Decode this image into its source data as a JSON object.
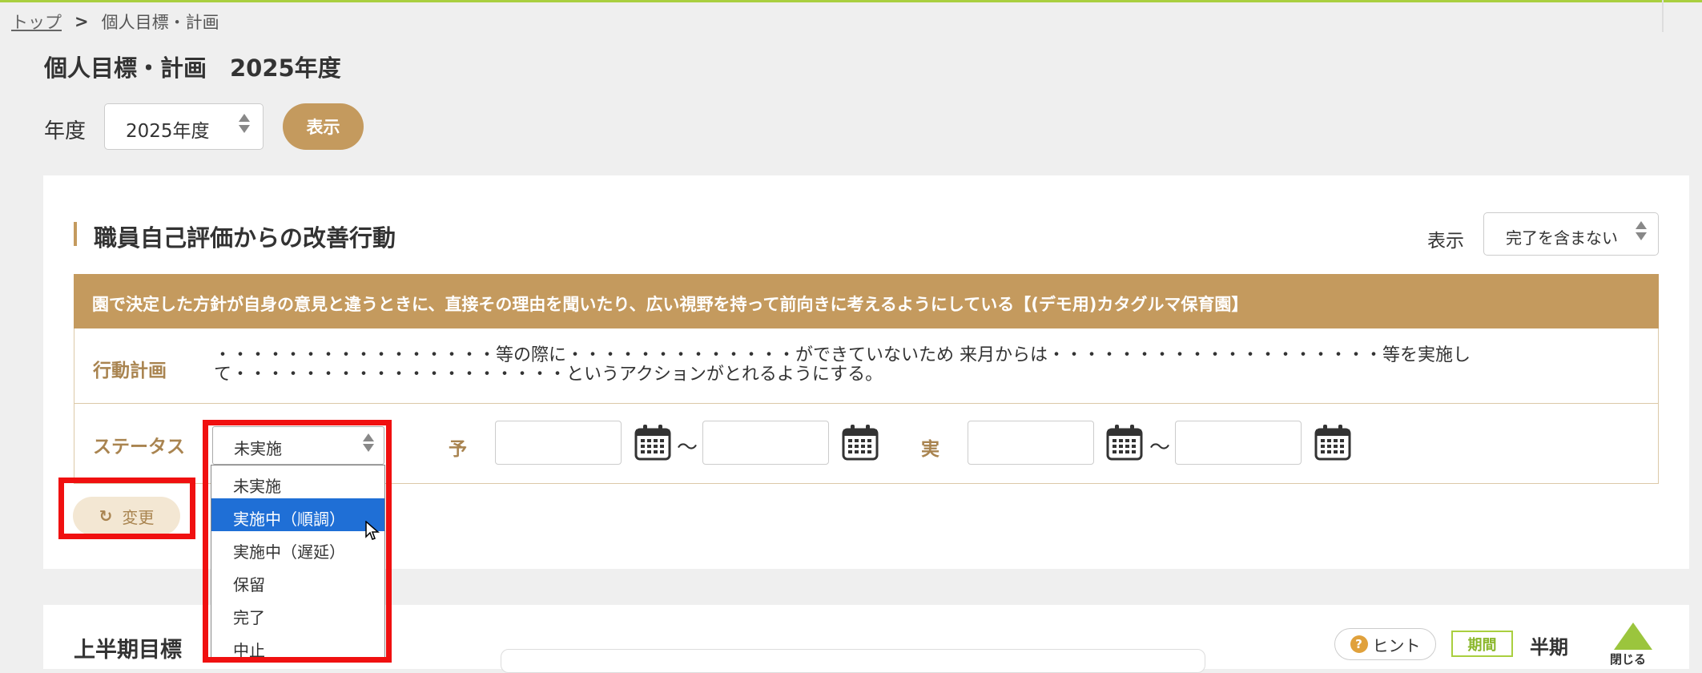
{
  "breadcrumb": {
    "home": "トップ",
    "separator": ">",
    "current": "個人目標・計画"
  },
  "page": {
    "title": "個人目標・計画　2025年度"
  },
  "year_filter": {
    "label": "年度",
    "selected": "2025年度",
    "show_button": "表示"
  },
  "section": {
    "title": "職員自己評価からの改善行動",
    "display_label": "表示",
    "display_selected": "完了を含まない",
    "goal_header": "園で決定した方針が自身の意見と違うときに、直接その理由を聞いたり、広い視野を持って前向きに考えるようにしている【(デモ用)カタグルマ保育園】",
    "plan_label": "行動計画",
    "plan_text": "・・・・・・・・・・・・・・・・等の際に・・・・・・・・・・・・・ができていないため 来月からは・・・・・・・・・・・・・・・・・・・等を実施して・・・・・・・・・・・・・・・・・・・というアクションがとれるようにする。",
    "status_label": "ステータス",
    "status_selected": "未実施",
    "planned_label": "予",
    "actual_label": "実",
    "tilde": "〜",
    "change_button": "変更"
  },
  "status_dropdown": {
    "options": [
      "未実施",
      "実施中（順調）",
      "実施中（遅延）",
      "保留",
      "完了",
      "中止"
    ],
    "highlighted_index": 1
  },
  "bottom": {
    "title": "上半期目標",
    "hint_button": "ヒント",
    "hint_icon": "?",
    "period_badge": "期間",
    "period_value": "半期",
    "collapse_label": "閉じる"
  },
  "colors": {
    "accent": "#c49a5e",
    "top_bar": "#a9cf3f",
    "highlight": "#1f6fd6",
    "annotation": "#f01010"
  }
}
